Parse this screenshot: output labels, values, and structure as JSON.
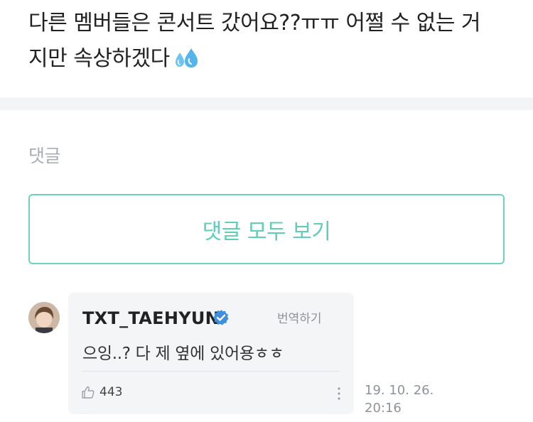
{
  "post": {
    "text_line1": "다른 멤버들은 콘서트 갔어요??ㅠㅠ 어쩔 수 없는 거",
    "text_line2": "지만 속상하겠다",
    "emoji_icon": "sweat-droplets-icon"
  },
  "comments": {
    "header_label": "댓글",
    "view_all_label": "댓글 모두 보기",
    "items": [
      {
        "author": "TXT_TAEHYUN",
        "verified_icon": "verified-badge-icon",
        "translate_label": "번역하기",
        "text": "으잉..? 다 제 옆에 있어용ㅎㅎ",
        "like_count": "443",
        "timestamp_line1": "19. 10. 26.",
        "timestamp_line2": "20:16"
      }
    ]
  },
  "colors": {
    "accent": "#5fcfb5",
    "accent_border": "#6dd3bc",
    "verified": "#3e8fe0",
    "bubble_bg": "#f4f5f7",
    "divider": "#f3f4f6"
  }
}
